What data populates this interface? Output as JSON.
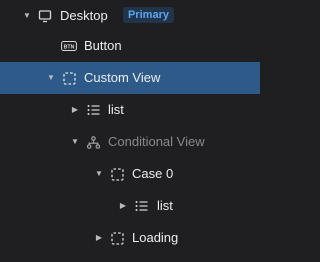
{
  "tree": {
    "desktop": {
      "label": "Desktop",
      "badge": "Primary"
    },
    "button": {
      "label": "Button",
      "icon_text": "BTN"
    },
    "custom_view": {
      "label": "Custom View"
    },
    "list_1": {
      "label": "list"
    },
    "conditional_view": {
      "label": "Conditional View"
    },
    "case_0": {
      "label": "Case 0"
    },
    "list_2": {
      "label": "list"
    },
    "loading": {
      "label": "Loading"
    }
  },
  "colors": {
    "background": "#1f1f21",
    "selection": "#2d5a88",
    "badge_text": "#5aa7f5",
    "badge_bg": "#22344a"
  }
}
